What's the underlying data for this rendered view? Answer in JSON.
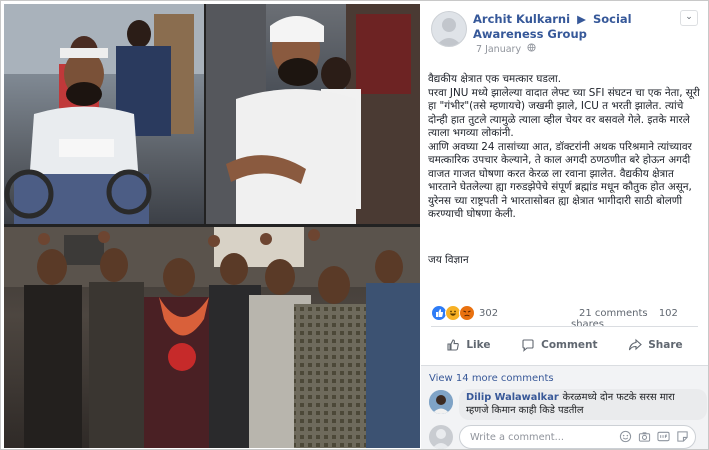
{
  "post": {
    "author": "Archit Kulkarni",
    "arrow": "▶",
    "group": "Social Awareness Group",
    "date": "7 January",
    "more": "⌄",
    "body_lines": [
      "वैद्यकीय क्षेत्रात एक चमत्कार घडला.",
      "परवा JNU मध्ये झालेल्या वादात लेफ्ट च्या SFI संघटन चा एक नेता, सूरी हा \"गंभीर\"(तसे म्हणायचे) जखमी झाले, ICU त भरती झालेत. त्यांचे दोन्ही हात तुटले त्यामुळे त्याला व्हील चेयर वर बसवले गेले. इतके मारले त्याला भगव्या लोकांनी.",
      "आणि अवघ्या 24 तासांच्या आत, डॉक्टरांनी अथक परिश्रमाने त्यांच्यावर चमत्कारिक उपचार केल्याने, ते काल अगदी ठणठणीत बरे होऊन अगदी वाजत गाजत घोषणा करत केरळ ला रवाना झालेत. वैद्यकीय क्षेत्रात भारताने घेतलेल्या ह्या गरुडझेपेचे संपूर्ण ब्रह्मांड मधून कौतुक होत असून, युरेनस च्या राष्ट्रपती ने भारतासोबत ह्या क्षेत्रात भागीदारी साठी बोलणी करण्याची घोषणा केली."
    ],
    "sign_off": "जय विज्ञान",
    "reaction_count": "302",
    "comments_count": "21 comments",
    "shares_count": "102 shares",
    "actions": {
      "like": "Like",
      "comment": "Comment",
      "share": "Share"
    },
    "view_more": "View 14 more comments",
    "comment": {
      "name": "Dilip Walawalkar",
      "text": "केरळमध्ये दोन फटके सरस मारा म्हणजे किमान काही किडे पडतील"
    },
    "compose_placeholder": "Write a comment..."
  },
  "icons": {
    "reactions": [
      "like-reaction-icon",
      "haha-reaction-icon",
      "angry-reaction-icon"
    ],
    "compose": [
      "emoji-icon",
      "camera-icon",
      "gif-icon",
      "sticker-icon"
    ]
  },
  "colors": {
    "link": "#365899",
    "like": "#2e7cf6",
    "meta": "#606770"
  }
}
